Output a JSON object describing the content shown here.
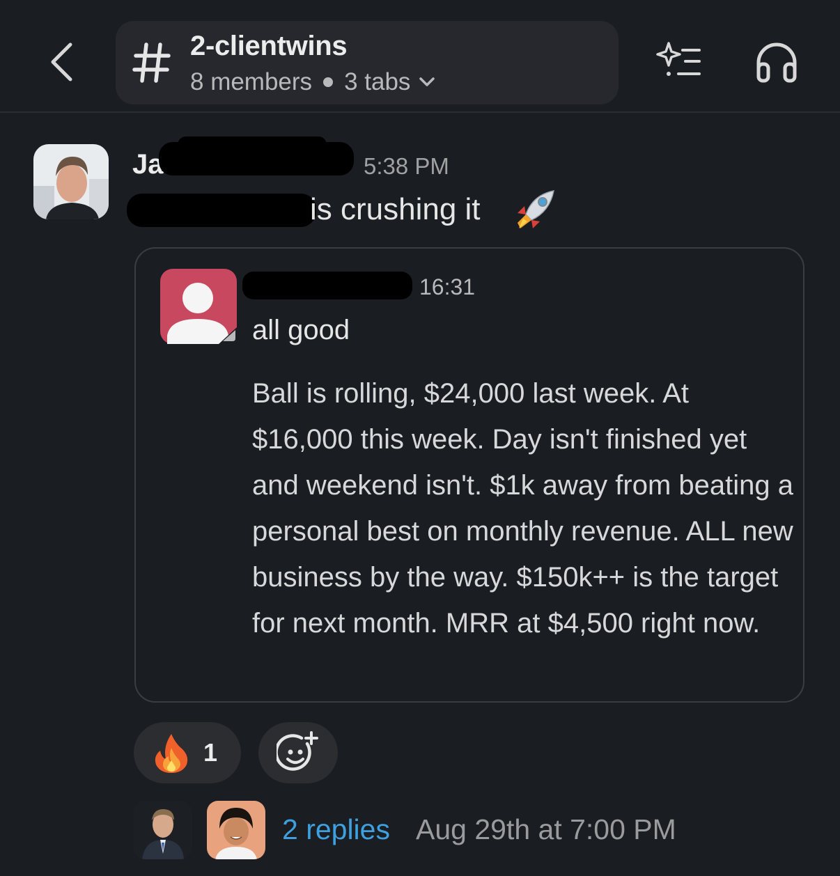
{
  "header": {
    "channel_name": "2-clientwins",
    "members": "8 members",
    "tabs": "3 tabs",
    "icons": [
      "back-chevron-icon",
      "hash-icon",
      "ai-sparkle-list-icon",
      "headphones-icon",
      "chevron-down-icon"
    ]
  },
  "message": {
    "author_visible": "Ja",
    "timestamp": "5:38 PM",
    "text_visible": "is crushing it",
    "emoji": "rocket",
    "redacted": true
  },
  "attachment": {
    "time": "16:31",
    "title": "all good",
    "body": "Ball is rolling, $24,000 last week. At $16,000 this week. Day isn't finished yet and weekend isn't. $1k away from beating a personal best on monthly revenue. ALL new business by the way. $150k++ is the target for next month. MRR at $4,500 right now.",
    "author_redacted": true
  },
  "reactions": [
    {
      "emoji": "fire",
      "count": "1"
    }
  ],
  "thread": {
    "replies": "2 replies",
    "last_reply": "Aug 29th at 7:00 PM"
  },
  "colors": {
    "background": "#1a1d21",
    "pill": "#26282d",
    "link": "#3fa0e0",
    "card_border": "#3b3d42",
    "card_avatar": "#c8485f"
  }
}
